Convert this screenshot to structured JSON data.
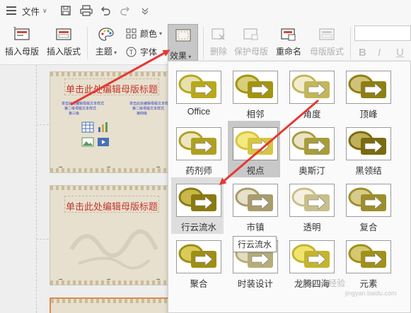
{
  "menubar": {
    "file_label": "文件"
  },
  "ribbon": {
    "insert_master": "插入母版",
    "insert_layout": "插入版式",
    "theme": "主题",
    "color": "颜色",
    "font": "字体",
    "effects": "效果",
    "delete": "删除",
    "protect_master": "保护母版",
    "rename": "重命名",
    "master_layout": "母版版式",
    "format_bold": "B",
    "format_italic": "I",
    "format_underline": "U"
  },
  "slides": {
    "master_title": "单击此处编辑母版标题",
    "layout_title": "单击此处编辑母版标题",
    "text_style_1": "单击此处编辑母版文本样式",
    "text_style_2": "第二级母版文本样式",
    "text_style_3": "第三级",
    "text_style_4": "第四级",
    "placeholder_mark": "▪▪▪"
  },
  "effects_panel": {
    "tiles": [
      {
        "name": "Office"
      },
      {
        "name": "相邻"
      },
      {
        "name": "角度"
      },
      {
        "name": "顶峰"
      },
      {
        "name": "药剂师"
      },
      {
        "name": "视点"
      },
      {
        "name": "奥斯汀"
      },
      {
        "name": "黑领结"
      },
      {
        "name": "行云流水"
      },
      {
        "name": "市镇"
      },
      {
        "name": "透明"
      },
      {
        "name": "复合"
      },
      {
        "name": "聚合"
      },
      {
        "name": "时装设计"
      },
      {
        "name": "龙腾四海"
      },
      {
        "name": "元素"
      }
    ],
    "tooltip": "行云流水"
  },
  "watermark": {
    "line1": "Baidu 经验",
    "line2": "jingyan.baidu.com"
  },
  "colors": {
    "accent_red": "#e53935",
    "gold": "#a49410",
    "ribbon_bg": "#f7f7f7"
  }
}
